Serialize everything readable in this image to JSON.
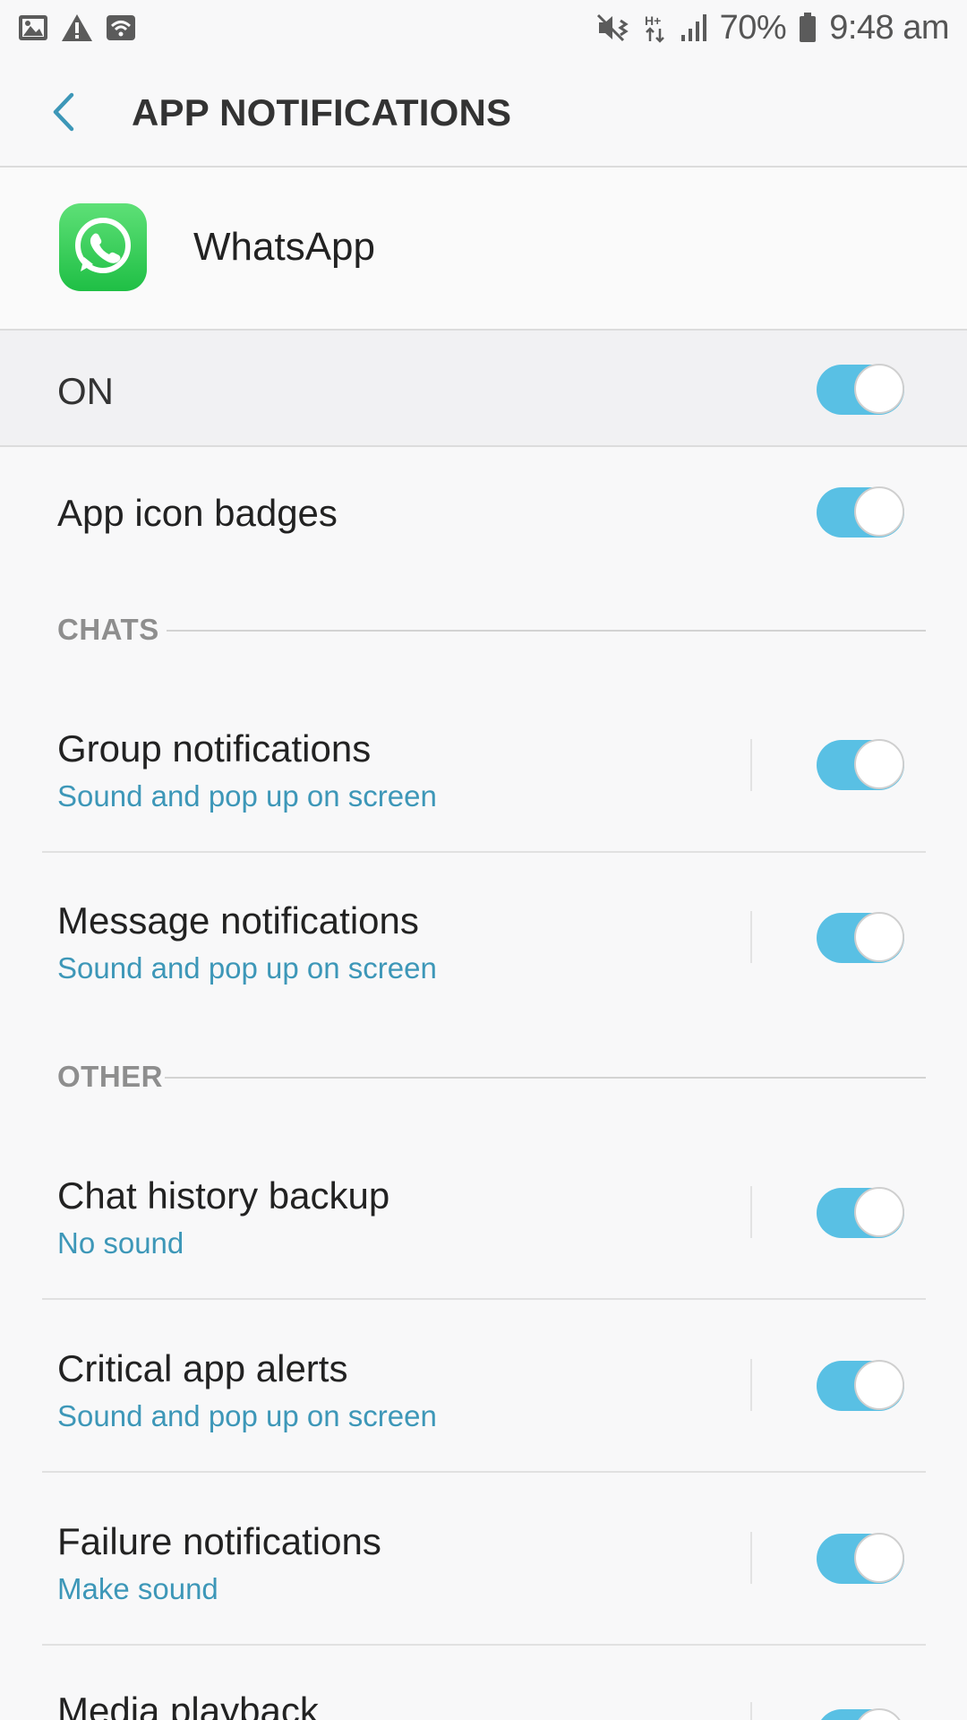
{
  "status_bar": {
    "battery_percent": "70%",
    "time": "9:48 am",
    "left_icons": [
      "image-icon",
      "warning-icon",
      "wifi-icon"
    ],
    "right_icons": [
      "mute-vibrate-icon",
      "hplus-data-icon",
      "signal-icon",
      "battery-icon"
    ]
  },
  "header": {
    "title": "APP NOTIFICATIONS",
    "back_icon": "chevron-left-icon"
  },
  "app": {
    "name": "WhatsApp",
    "icon": "whatsapp-logo"
  },
  "master": {
    "label": "ON",
    "enabled": true
  },
  "badges": {
    "label": "App icon badges",
    "enabled": true
  },
  "sections": [
    {
      "header": "CHATS",
      "items": [
        {
          "title": "Group notifications",
          "subtitle": "Sound and pop up on screen",
          "enabled": true
        },
        {
          "title": "Message notifications",
          "subtitle": "Sound and pop up on screen",
          "enabled": true
        }
      ]
    },
    {
      "header": "OTHER",
      "items": [
        {
          "title": "Chat history backup",
          "subtitle": "No sound",
          "enabled": true
        },
        {
          "title": "Critical app alerts",
          "subtitle": "Sound and pop up on screen",
          "enabled": true
        },
        {
          "title": "Failure notifications",
          "subtitle": "Make sound",
          "enabled": true
        },
        {
          "title": "Media playback",
          "subtitle": "",
          "enabled": true
        }
      ]
    }
  ],
  "colors": {
    "accent": "#59c0e4",
    "subtitle": "#3d97b8",
    "whatsapp_green": "#25d366"
  }
}
